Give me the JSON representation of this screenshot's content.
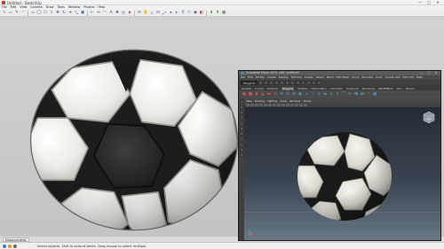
{
  "sketchup": {
    "title": "Untitled - SketchUp",
    "window_controls": [
      "—",
      "□",
      "✕"
    ],
    "menu": [
      "File",
      "Edit",
      "View",
      "Camera",
      "Draw",
      "Tools",
      "Window",
      "Plugins",
      "Help"
    ],
    "toolbar_icons": [
      {
        "name": "select-arrow-icon",
        "glyph": "↖"
      },
      {
        "name": "eraser-icon",
        "glyph": "▱"
      },
      {
        "name": "pencil-icon",
        "glyph": "✎"
      },
      {
        "name": "arc-icon",
        "glyph": "◜"
      },
      {
        "name": "rectangle-icon",
        "glyph": "▭"
      },
      {
        "name": "circle-icon",
        "glyph": "◯"
      },
      {
        "name": "polygon-icon",
        "glyph": "⬠"
      },
      {
        "name": "push-pull-icon",
        "glyph": "⇪"
      },
      {
        "name": "move-icon",
        "glyph": "✥"
      },
      {
        "name": "rotate-icon",
        "glyph": "↻"
      },
      {
        "name": "follow-me-icon",
        "glyph": "➜"
      },
      {
        "name": "scale-icon",
        "glyph": "⤡"
      },
      {
        "name": "offset-icon",
        "glyph": "▣"
      },
      {
        "name": "tape-measure-icon",
        "glyph": "⊢"
      },
      {
        "name": "dimension-icon",
        "glyph": "↔"
      },
      {
        "name": "protractor-icon",
        "glyph": "◠"
      },
      {
        "name": "text-icon",
        "glyph": "A"
      },
      {
        "name": "axes-icon",
        "glyph": "✚"
      },
      {
        "name": "3d-text-icon",
        "glyph": "Ⓐ"
      },
      {
        "name": "paint-bucket-icon",
        "glyph": "◈"
      },
      {
        "name": "orbit-icon",
        "glyph": "⟳"
      },
      {
        "name": "pan-icon",
        "glyph": "✋"
      },
      {
        "name": "zoom-icon",
        "glyph": "⌕"
      },
      {
        "name": "zoom-window-icon",
        "glyph": "⊡"
      },
      {
        "name": "zoom-extents-icon",
        "glyph": "⤢"
      },
      {
        "name": "previous-view-icon",
        "glyph": "◂"
      },
      {
        "name": "next-view-icon",
        "glyph": "▸"
      },
      {
        "name": "position-camera-icon",
        "glyph": "⚲"
      },
      {
        "name": "walk-icon",
        "glyph": "⚇"
      },
      {
        "name": "look-around-icon",
        "glyph": "◉"
      },
      {
        "name": "section-plane-icon",
        "glyph": "◧"
      },
      {
        "name": "get-models-icon",
        "glyph": "⬇"
      },
      {
        "name": "share-model-icon",
        "glyph": "⬆"
      },
      {
        "name": "components-icon",
        "glyph": "▦"
      }
    ],
    "scene_tab": "Measurements",
    "status_text": "Select objects. Shift to extend select. Drag mouse to select multiple.",
    "status_icon_colors": [
      "#3a7bd5",
      "#d4a017",
      "#6a6a6a"
    ]
  },
  "maya": {
    "title": "Autodesk Maya 2011 x64: untitled*",
    "window_controls": [
      "—",
      "□",
      "✕"
    ],
    "menu": [
      "File",
      "Edit",
      "Modify",
      "Create",
      "Display",
      "Window",
      "Assets",
      "Select",
      "Mesh",
      "Edit Mesh",
      "Proxy",
      "Normals",
      "Color",
      "Create UVs",
      "Edit UVs",
      "Help"
    ],
    "mode": "Polygons",
    "shelf_tabs": [
      "General",
      "Curves",
      "Surfaces",
      "Polygons",
      "Subdivs",
      "Deformation",
      "Animation",
      "Dynamics",
      "Rendering",
      "PaintEffects",
      "Toon",
      "Muscle"
    ],
    "active_shelf_tab": "Polygons",
    "shelf_icons": [
      {
        "name": "sphere-icon",
        "glyph": "●",
        "tone": "red"
      },
      {
        "name": "cube-icon",
        "glyph": "■",
        "tone": "red"
      },
      {
        "name": "cylinder-icon",
        "glyph": "▮",
        "tone": "red"
      },
      {
        "name": "cone-icon",
        "glyph": "▲",
        "tone": "red"
      },
      {
        "name": "plane-icon",
        "glyph": "▬",
        "tone": "red"
      },
      {
        "name": "torus-icon",
        "glyph": "◎",
        "tone": "red"
      },
      {
        "name": "combine-icon",
        "glyph": "⊕",
        "tone": "blue"
      },
      {
        "name": "separate-icon",
        "glyph": "⊖",
        "tone": "blue"
      },
      {
        "name": "extract-icon",
        "glyph": "⊗",
        "tone": "blue"
      },
      {
        "name": "smooth-icon",
        "glyph": "◍",
        "tone": "cyan"
      },
      {
        "name": "union-icon",
        "glyph": "∪",
        "tone": "blue"
      },
      {
        "name": "difference-icon",
        "glyph": "∖",
        "tone": "blue"
      },
      {
        "name": "intersection-icon",
        "glyph": "∩",
        "tone": "blue"
      },
      {
        "name": "mirror-icon",
        "glyph": "⇋",
        "tone": "cyan"
      },
      {
        "name": "bevel-icon",
        "glyph": "◇",
        "tone": "cyan"
      },
      {
        "name": "extrude-icon",
        "glyph": "⇧",
        "tone": "cyan"
      },
      {
        "name": "bridge-icon",
        "glyph": "⌒",
        "tone": "cyan"
      },
      {
        "name": "split-icon",
        "glyph": "✂",
        "tone": "cyan"
      },
      {
        "name": "insert-loop-icon",
        "glyph": "⊞",
        "tone": "cyan"
      },
      {
        "name": "merge-icon",
        "glyph": "⋈",
        "tone": "cyan"
      },
      {
        "name": "sculpt-icon",
        "glyph": "✎",
        "tone": "red"
      },
      {
        "name": "uv-editor-icon",
        "glyph": "▦",
        "tone": "blue"
      }
    ],
    "panel_menu": [
      "View",
      "Shading",
      "Lighting",
      "Show",
      "Renderer",
      "Panels"
    ],
    "cube_label": "FRONT"
  }
}
